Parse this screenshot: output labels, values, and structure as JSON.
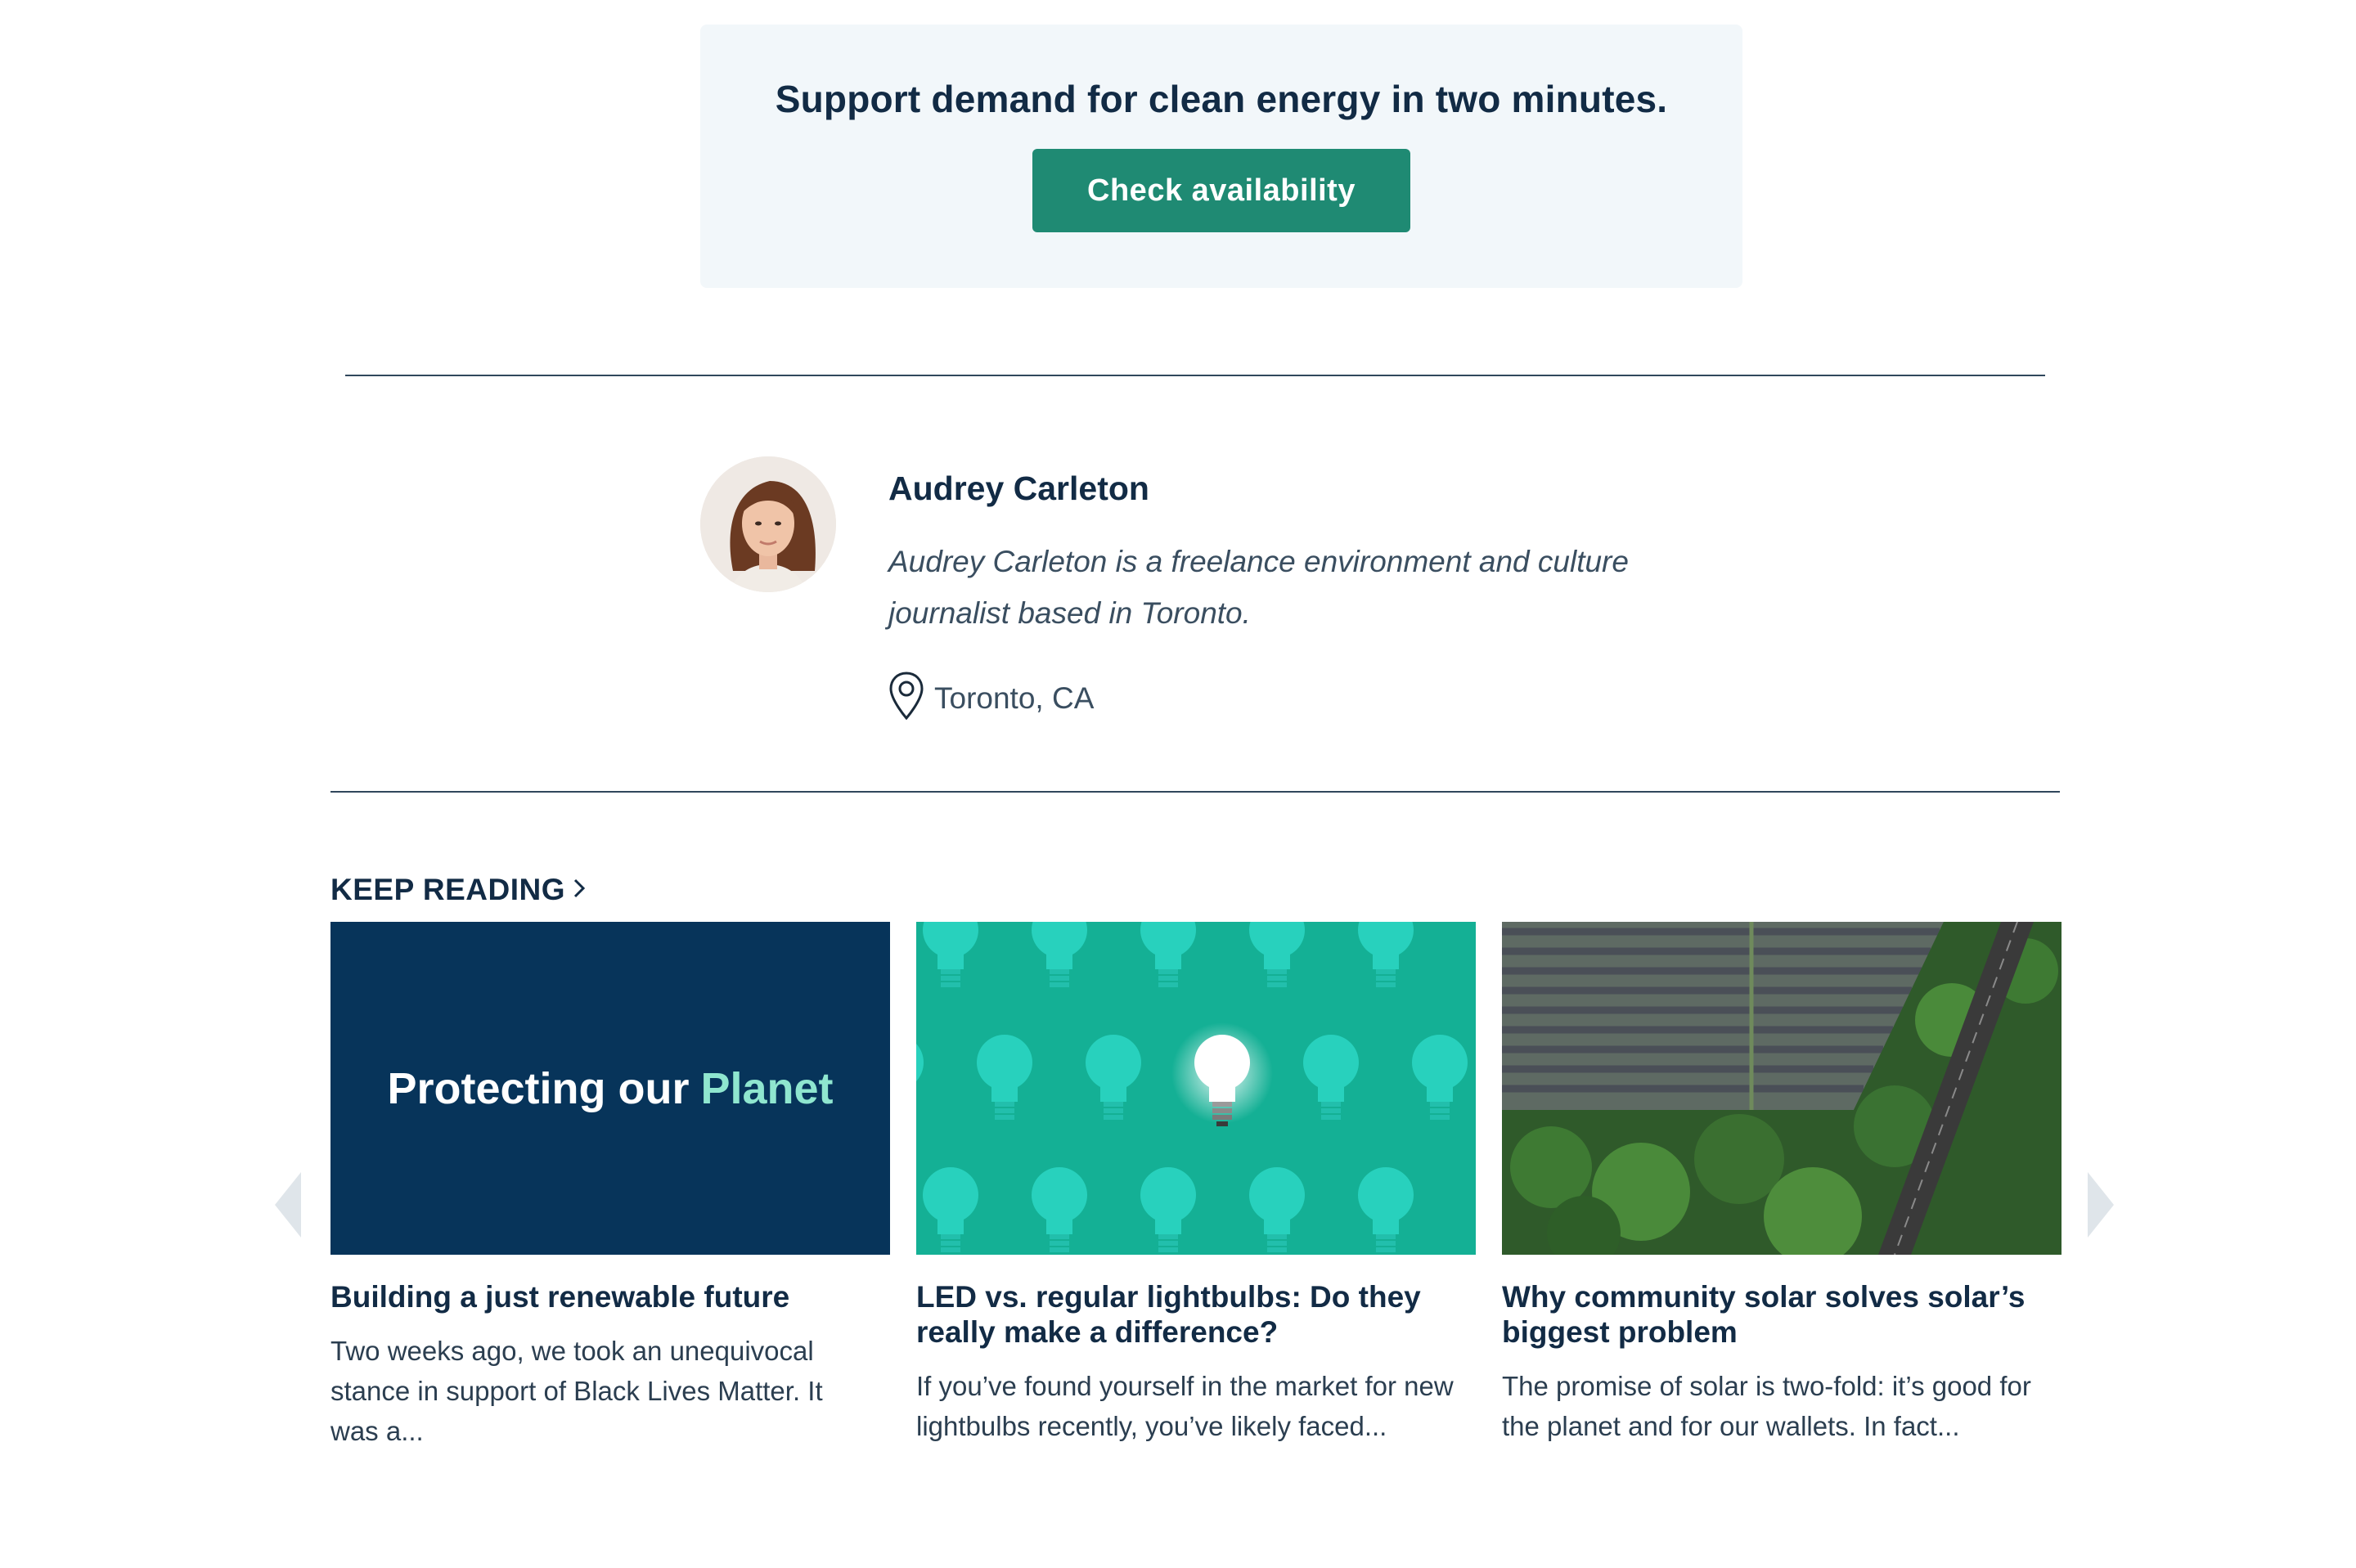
{
  "cta": {
    "text": "Support demand for clean energy in two minutes.",
    "button_label": "Check availability"
  },
  "author": {
    "name": "Audrey Carleton",
    "bio": "Audrey Carleton is a freelance environment and culture journalist based in Toronto.",
    "location": "Toronto, CA"
  },
  "keep_reading": {
    "label": "KEEP READING",
    "cards": [
      {
        "image_text_main": "Protecting our",
        "image_text_accent": "Planet",
        "title": "Building a just renewable future",
        "excerpt": "Two weeks ago, we took an unequivocal stance in support of Black Lives Matter. It was a..."
      },
      {
        "title": "LED vs. regular lightbulbs: Do they really make a difference?",
        "excerpt": "If you’ve found yourself in the market for new lightbulbs recently, you’ve likely faced..."
      },
      {
        "title": "Why community solar solves solar’s biggest problem",
        "excerpt": "The promise of solar is two-fold: it’s good for the planet and for our wallets. In fact..."
      }
    ]
  },
  "colors": {
    "primary_button": "#1f8a73",
    "navy": "#07345a",
    "teal_bg": "#14b095",
    "accent_mint": "#8fe6cf"
  },
  "icons": [
    "location-pin-icon",
    "chevron-right-icon",
    "carousel-left-arrow-icon",
    "carousel-right-arrow-icon"
  ]
}
